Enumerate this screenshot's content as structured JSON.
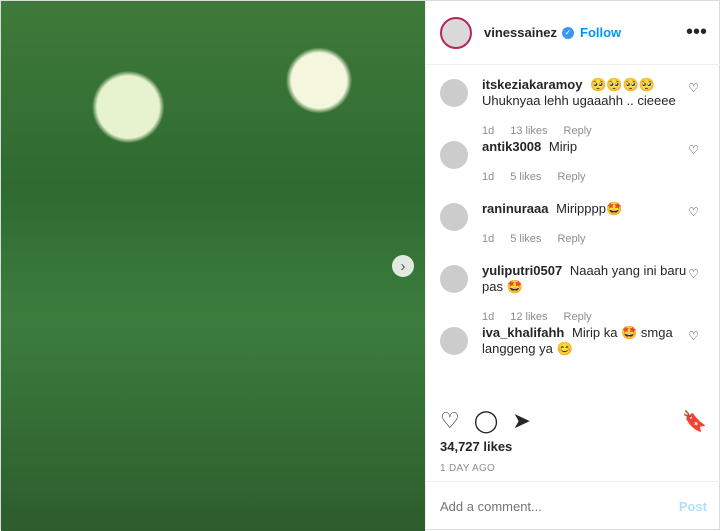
{
  "header": {
    "username": "vinessainez",
    "follow_label": "Follow",
    "more_label": "•••",
    "verified_label": "✓"
  },
  "photo": {
    "next_label": "›"
  },
  "comments": [
    {
      "user": "itskeziakaramoy",
      "text": "🥺🥺🥺🥺\nUhuknyaa lehh ugaaahh .. cieeee",
      "age": "1d",
      "likes": "13 likes",
      "reply": "Reply"
    },
    {
      "user": "antik3008",
      "text": "Mirip",
      "age": "1d",
      "likes": "5 likes",
      "reply": "Reply"
    },
    {
      "user": "raninuraaa",
      "text": "Miripppp🤩",
      "age": "1d",
      "likes": "5 likes",
      "reply": "Reply"
    },
    {
      "user": "yuliputri0507",
      "text": "Naaah yang ini baru pas 🤩",
      "age": "1d",
      "likes": "12 likes",
      "reply": "Reply"
    },
    {
      "user": "iva_khalifahh",
      "text": "Mirip ka 🤩 smga langgeng ya 😊",
      "age": "",
      "likes": "",
      "reply": ""
    }
  ],
  "actions": {
    "likes": "34,727 likes",
    "time": "1 DAY AGO"
  },
  "input": {
    "placeholder": "Add a comment...",
    "post_label": "Post"
  }
}
